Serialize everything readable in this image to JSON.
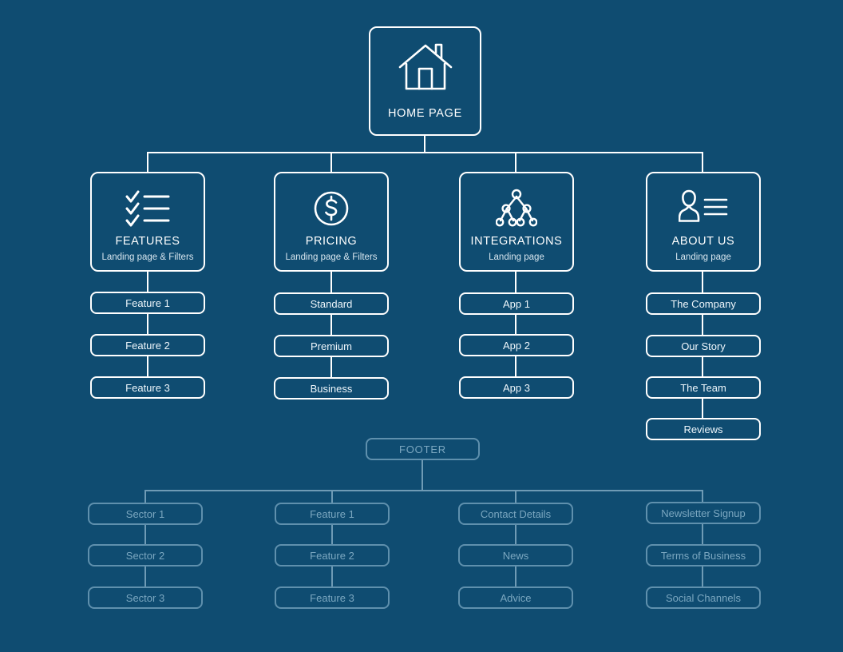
{
  "theme": {
    "background": "#0f4c71",
    "line": "#ffffff",
    "line_dim": "#6f9bb5",
    "text": "#ffffff",
    "text_dim": "#7ba7c0"
  },
  "root": {
    "label": "HOME PAGE",
    "icon": "house-icon"
  },
  "categories": [
    {
      "title": "FEATURES",
      "subtitle": "Landing page & Filters",
      "icon": "checklist-icon",
      "children": [
        "Feature 1",
        "Feature 2",
        "Feature 3"
      ]
    },
    {
      "title": "PRICING",
      "subtitle": "Landing page & Filters",
      "icon": "dollar-circle-icon",
      "children": [
        "Standard",
        "Premium",
        "Business"
      ]
    },
    {
      "title": "INTEGRATIONS",
      "subtitle": "Landing page",
      "icon": "network-tree-icon",
      "children": [
        "App 1",
        "App 2",
        "App 3"
      ]
    },
    {
      "title": "ABOUT US",
      "subtitle": "Landing page",
      "icon": "person-lines-icon",
      "children": [
        "The Company",
        "Our Story",
        "The Team",
        "Reviews"
      ]
    }
  ],
  "footer": {
    "label": "FOOTER",
    "columns": [
      {
        "items": [
          "Sector 1",
          "Sector 2",
          "Sector 3"
        ]
      },
      {
        "items": [
          "Feature 1",
          "Feature 2",
          "Feature 3"
        ]
      },
      {
        "items": [
          "Contact Details",
          "News",
          "Advice"
        ]
      },
      {
        "items": [
          "Newsletter Signup",
          "Terms of Business",
          "Social Channels"
        ]
      }
    ]
  }
}
